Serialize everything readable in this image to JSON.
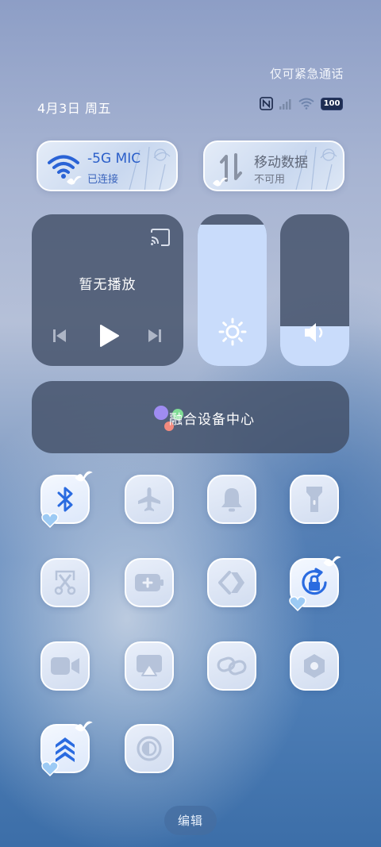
{
  "status": {
    "emergency_text": "仅可紧急通话",
    "date_text": "4月3日 周五",
    "battery_level": "100",
    "icons": [
      "nfc-icon",
      "signal-icon",
      "wifi-icon",
      "battery-icon"
    ]
  },
  "network": {
    "wifi": {
      "title": "-5G   MIC",
      "sub": "已连接",
      "icon": "wifi-icon",
      "active": true
    },
    "mobile_data": {
      "title": "移动数据",
      "sub": "不可用",
      "icon": "data-arrows-icon",
      "active": false
    }
  },
  "media": {
    "status_text": "暂无播放",
    "controls": [
      "prev-icon",
      "play-icon",
      "next-icon",
      "cast-icon"
    ]
  },
  "sliders": {
    "brightness": {
      "level": 0.93,
      "icon": "sun-icon"
    },
    "volume": {
      "level": 0.26,
      "icon": "speaker-icon"
    }
  },
  "device_center": {
    "label": "融合设备中心"
  },
  "toggles": [
    {
      "name": "bluetooth",
      "icon": "bluetooth-icon",
      "active": true
    },
    {
      "name": "airplane",
      "icon": "airplane-icon",
      "active": false
    },
    {
      "name": "bell",
      "icon": "bell-icon",
      "active": false
    },
    {
      "name": "flashlight",
      "icon": "flashlight-icon",
      "active": false
    },
    {
      "name": "screenshot",
      "icon": "scissors-icon",
      "active": false
    },
    {
      "name": "battery-saver",
      "icon": "battery-plus-icon",
      "active": false
    },
    {
      "name": "nearby-share",
      "icon": "share-arrows-icon",
      "active": false
    },
    {
      "name": "rotation-lock",
      "icon": "rotation-lock-icon",
      "active": true
    },
    {
      "name": "screen-record",
      "icon": "camera-icon",
      "active": false
    },
    {
      "name": "screen-cast",
      "icon": "cast-screen-icon",
      "active": false
    },
    {
      "name": "link",
      "icon": "link-icon",
      "active": false
    },
    {
      "name": "settings",
      "icon": "hexagon-icon",
      "active": false
    },
    {
      "name": "performance",
      "icon": "chevrons-up-icon",
      "active": true
    },
    {
      "name": "dark-mode",
      "icon": "contrast-icon",
      "active": false
    }
  ],
  "colors": {
    "accent": "#2a6be0",
    "inactive_icon": "#b6c3da",
    "tile_dark": "#424f68"
  },
  "edit_label": "编辑"
}
